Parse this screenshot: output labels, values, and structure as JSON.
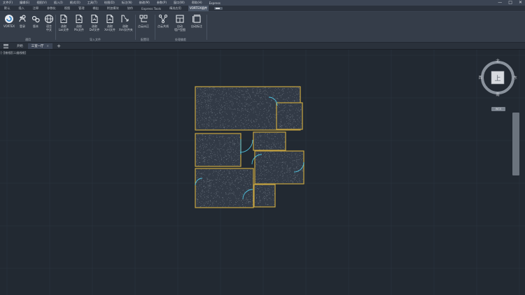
{
  "menubar": {
    "items": [
      "文件(F)",
      "编辑(E)",
      "视图(V)",
      "插入(I)",
      "格式(O)",
      "工具(T)",
      "绘图(D)",
      "标注(N)",
      "修改(M)",
      "参数(P)",
      "窗口(W)",
      "帮助(H)",
      "Express"
    ],
    "window_controls": [
      "—",
      "□",
      "✕"
    ]
  },
  "ribbon_tabs": {
    "items": [
      "默认",
      "插入",
      "注释",
      "参数化",
      "视图",
      "管理",
      "输出",
      "附加模块",
      "协作",
      "Express Tools",
      "精选应用",
      "VORTEX插件"
    ],
    "active": "VORTEX插件"
  },
  "ribbon": {
    "groups": [
      {
        "caption": "通用",
        "buttons": [
          {
            "label": "VORTEX",
            "icon": "vortex-logo-icon"
          },
          {
            "label": "登录",
            "icon": "login-icon"
          },
          {
            "label": "版本",
            "icon": "version-icon"
          },
          {
            "label": "语言\n中文",
            "icon": "globe-icon"
          }
        ]
      },
      {
        "caption": "导入文件",
        "buttons": [
          {
            "label": "选取\nLas文件",
            "icon": "las-file-icon"
          },
          {
            "label": "选取\nPts文件",
            "icon": "pts-file-icon"
          },
          {
            "label": "选取\nDxf文件",
            "icon": "dxf-file-icon"
          },
          {
            "label": "选取\nXml文件",
            "icon": "xml-file-icon"
          },
          {
            "label": "选取\nXml文件夹",
            "icon": "folder-icon"
          }
        ]
      },
      {
        "caption": "配置项",
        "buttons": [
          {
            "label": "点云纠正",
            "icon": "cloud-correct-icon"
          }
        ]
      },
      {
        "caption": "处理偏差",
        "buttons": [
          {
            "label": "点云共线",
            "icon": "collinear-icon"
          },
          {
            "label": "自动\n墙户型图",
            "icon": "floorplan-icon"
          },
          {
            "label": "自动标注",
            "icon": "auto-dimension-icon"
          }
        ]
      }
    ]
  },
  "doc_tabs": {
    "items": [
      {
        "label": "开始",
        "active": false,
        "closable": false
      },
      {
        "label": "三室一厅",
        "active": true,
        "closable": true
      }
    ],
    "close_glyph": "×",
    "add_glyph": "+"
  },
  "viewport": {
    "label": "[-][俯视][二维线框]"
  },
  "viewcube": {
    "top": "上",
    "north": "北",
    "south": "南",
    "east": "东",
    "west": "西",
    "wcs": "WCS"
  },
  "colors": {
    "background": "#222932",
    "grid": "#2c343e",
    "wall_outline": "#c9a640",
    "room_fill": "#323a46",
    "door_arc": "#4fc3e0",
    "accent_tab": "#4a5566"
  }
}
